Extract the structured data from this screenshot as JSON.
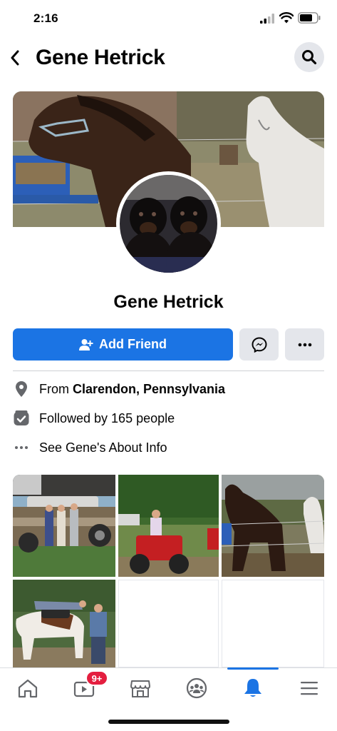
{
  "status_bar": {
    "time": "2:16"
  },
  "header": {
    "title": "Gene Hetrick"
  },
  "profile": {
    "name": "Gene Hetrick",
    "add_friend_label": "Add Friend"
  },
  "info": {
    "from_prefix": "From ",
    "from_place": "Clarendon, Pennsylvania",
    "followers": "Followed by 165 people",
    "about": "See Gene's About Info"
  },
  "tabbar": {
    "video_badge": "9+",
    "active_tab": "notifications"
  },
  "colors": {
    "accent": "#1b74e4",
    "badge": "#e41e3f",
    "button_gray": "#e4e6eb"
  },
  "icons": [
    "back-arrow-icon",
    "search-icon",
    "add-friend-icon",
    "messenger-icon",
    "more-icon",
    "location-icon",
    "followers-icon",
    "more-dots-icon",
    "home-icon",
    "video-icon",
    "marketplace-icon",
    "groups-icon",
    "bell-icon",
    "menu-icon"
  ]
}
